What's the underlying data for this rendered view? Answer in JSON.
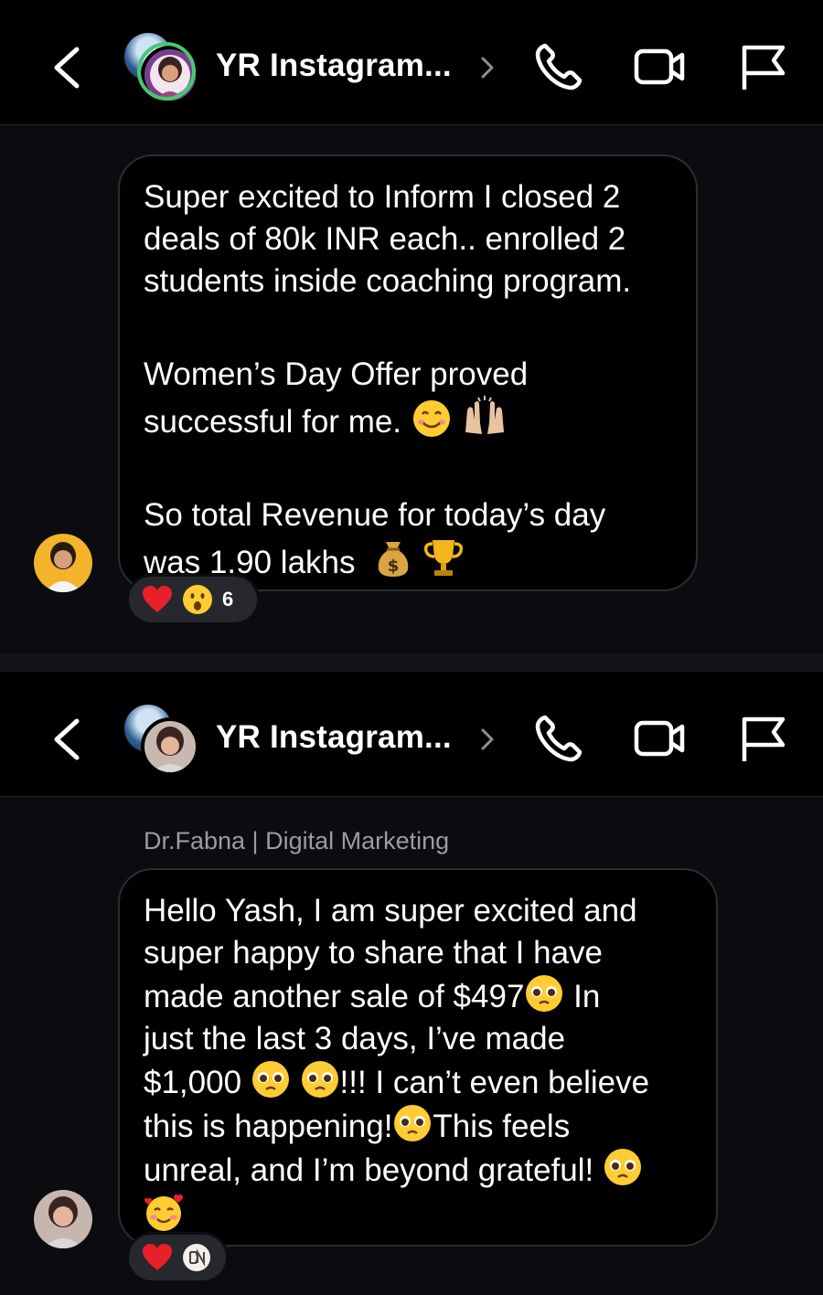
{
  "panels": [
    {
      "header": {
        "title": "YR Instagram..."
      },
      "message": {
        "lines": [
          "Super excited to Inform I closed 2",
          "deals of 80k INR each.. enrolled 2",
          "students inside coaching program.",
          "Women’s Day Offer proved",
          "successful for me.",
          "So total Revenue for today’s day",
          "was 1.90 lakhs"
        ]
      },
      "reactions": {
        "count": "6"
      }
    },
    {
      "header": {
        "title": "YR Instagram..."
      },
      "sender_name": "Dr.Fabna | Digital Marketing",
      "message": {
        "lines": [
          "Hello Yash, I am super excited and",
          "super happy to share that I have",
          "made another sale of  $497",
          "In",
          "just the last 3 days, I’ve made",
          "$1,000",
          "!!! I can’t even believe",
          "this is happening!",
          "This feels",
          "unreal, and I’m beyond grateful!"
        ]
      }
    }
  ],
  "icons": {
    "back": "chevron-left-icon",
    "chevron": "chevron-right-icon",
    "call": "phone-icon",
    "video": "video-camera-icon",
    "report": "flag-icon",
    "heart": "red-heart-emoji",
    "surprised": "surprised-face-emoji",
    "smile": "smiling-face-emoji",
    "raised_hands": "raising-hands-emoji",
    "money_bag": "money-bag-emoji",
    "trophy": "trophy-emoji",
    "pleading": "pleading-face-emoji",
    "hearts_face": "smiling-face-with-hearts-emoji",
    "reactor_avatar": "reactor-avatar-icon"
  },
  "colors": {
    "background": "#000000",
    "chat_background": "#0b0c10",
    "bubble_border": "#2b2d33",
    "reaction_pill": "#26282e",
    "sender_text": "#9a9ca3",
    "story_ring": "#48c774"
  }
}
